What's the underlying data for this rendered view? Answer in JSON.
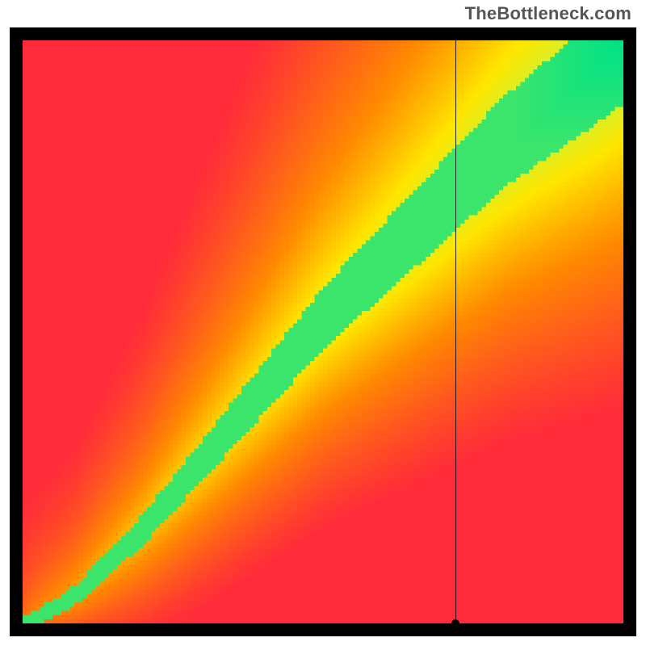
{
  "attribution": "TheBottleneck.com",
  "chart_data": {
    "type": "heatmap",
    "title": "",
    "xlabel": "",
    "ylabel": "",
    "xlim": [
      0,
      100
    ],
    "ylim": [
      0,
      100
    ],
    "legend": false,
    "grid": false,
    "colorscale": {
      "low": "#ff2a3a",
      "mid_low": "#ff8a00",
      "mid": "#ffe600",
      "mid_high": "#d4f02a",
      "high": "#00e186"
    },
    "optimal_curve": {
      "description": "approximate centerline of the green optimal band, as (x, y) in 0–100 coords",
      "points": [
        [
          0,
          0
        ],
        [
          3,
          1.5
        ],
        [
          6,
          3
        ],
        [
          9,
          5
        ],
        [
          12,
          8
        ],
        [
          15,
          11
        ],
        [
          20,
          16
        ],
        [
          25,
          22
        ],
        [
          30,
          28
        ],
        [
          35,
          34
        ],
        [
          40,
          40
        ],
        [
          45,
          46
        ],
        [
          50,
          52
        ],
        [
          55,
          57
        ],
        [
          60,
          62
        ],
        [
          65,
          67
        ],
        [
          70,
          72
        ],
        [
          75,
          77
        ],
        [
          80,
          82
        ],
        [
          85,
          86
        ],
        [
          90,
          90
        ],
        [
          95,
          94
        ],
        [
          100,
          98
        ]
      ],
      "band_half_width_start": 1.0,
      "band_half_width_end": 9.0
    },
    "marker": {
      "x": 72,
      "y": 0
    },
    "heatmap_resolution": 140
  }
}
